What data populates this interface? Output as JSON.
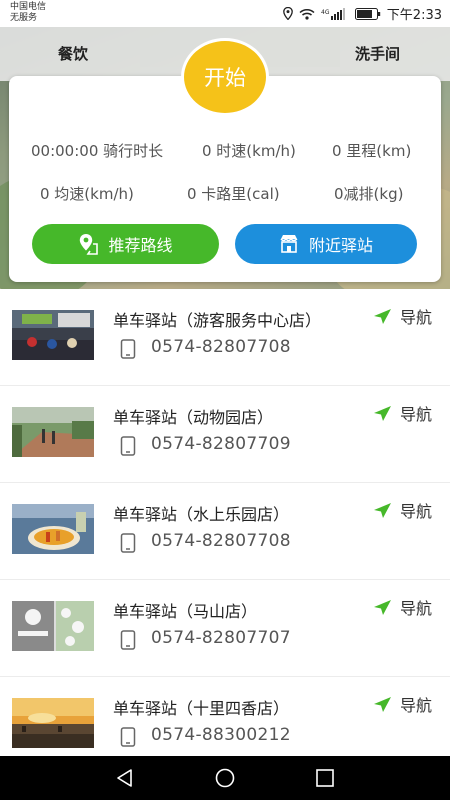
{
  "status_bar": {
    "carrier_line1": "中国电信",
    "carrier_line2": "无服务",
    "network_badge": "4G",
    "time": "下午2:33",
    "icons": [
      "location-icon",
      "wifi-icon",
      "signal-icon",
      "battery-icon"
    ]
  },
  "header": {
    "left_label": "餐饮",
    "right_label": "洗手间"
  },
  "start_button": {
    "label": "开始",
    "color": "#f5c219"
  },
  "stats": {
    "ride_duration": "00:00:00 骑行时长",
    "speed": "0 时速(km/h)",
    "distance": "0 里程(km)",
    "avg_speed": "0 均速(km/h)",
    "calories": "0 卡路里(cal)",
    "emission": "0减排(kg)"
  },
  "actions": {
    "recommend_route": "推荐路线",
    "nearby_station": "附近驿站",
    "green": "#46b82a",
    "blue": "#1d8fdc"
  },
  "stations": [
    {
      "name": "单车驿站（游客服务中心店）",
      "phone": "0574-82807708",
      "nav_label": "导航",
      "thumb_icon": "station-photo-visitor-center"
    },
    {
      "name": "单车驿站（动物园店）",
      "phone": "0574-82807709",
      "nav_label": "导航",
      "thumb_icon": "station-photo-zoo"
    },
    {
      "name": "单车驿站（水上乐园店）",
      "phone": "0574-82807708",
      "nav_label": "导航",
      "thumb_icon": "station-photo-water-park"
    },
    {
      "name": "单车驿站（马山店）",
      "phone": "0574-82807707",
      "nav_label": "导航",
      "thumb_icon": "station-photo-mashan"
    },
    {
      "name": "单车驿站（十里四香店）",
      "phone": "0574-88300212",
      "nav_label": "导航",
      "thumb_icon": "station-photo-shili"
    }
  ],
  "android_nav": [
    "back-icon",
    "home-icon",
    "recent-apps-icon"
  ]
}
